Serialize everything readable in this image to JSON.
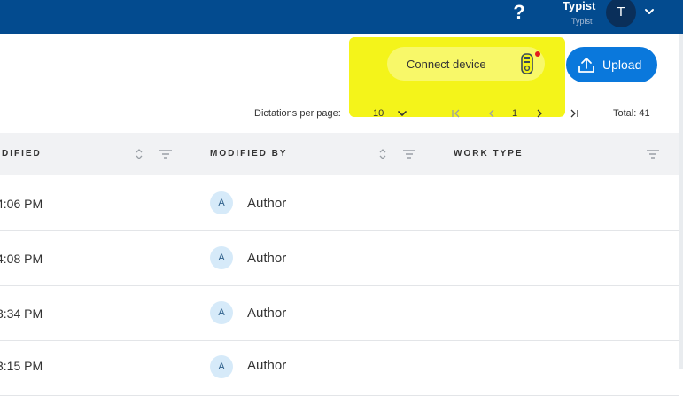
{
  "header": {
    "help_symbol": "?",
    "user_name": "Typist",
    "user_role": "Typist",
    "avatar_initial": "T"
  },
  "toolbar": {
    "connect_label": "Connect device",
    "upload_label": "Upload"
  },
  "pager": {
    "per_page_label": "Dictations per page:",
    "page_size": "10",
    "current_page": "1",
    "total": "Total: 41"
  },
  "table": {
    "columns": [
      "DIFIED",
      "MODIFIED BY",
      "WORK TYPE"
    ],
    "rows": [
      {
        "modified": "4:06 PM",
        "avatar": "A",
        "modified_by": "Author",
        "work_type": ""
      },
      {
        "modified": "4:08 PM",
        "avatar": "A",
        "modified_by": "Author",
        "work_type": ""
      },
      {
        "modified": "3:34 PM",
        "avatar": "A",
        "modified_by": "Author",
        "work_type": ""
      },
      {
        "modified": "3:15 PM",
        "avatar": "A",
        "modified_by": "Author",
        "work_type": ""
      }
    ]
  },
  "colors": {
    "header_bg": "#034b8f",
    "accent": "#0a78dc",
    "highlight": "#f4f41a",
    "status_dot": "#e31c1c"
  },
  "icons": [
    "help-icon",
    "chevron-down-icon",
    "usb-device-icon",
    "upload-icon",
    "first-page-icon",
    "prev-page-icon",
    "next-page-icon",
    "last-page-icon",
    "sort-icon",
    "filter-icon"
  ]
}
